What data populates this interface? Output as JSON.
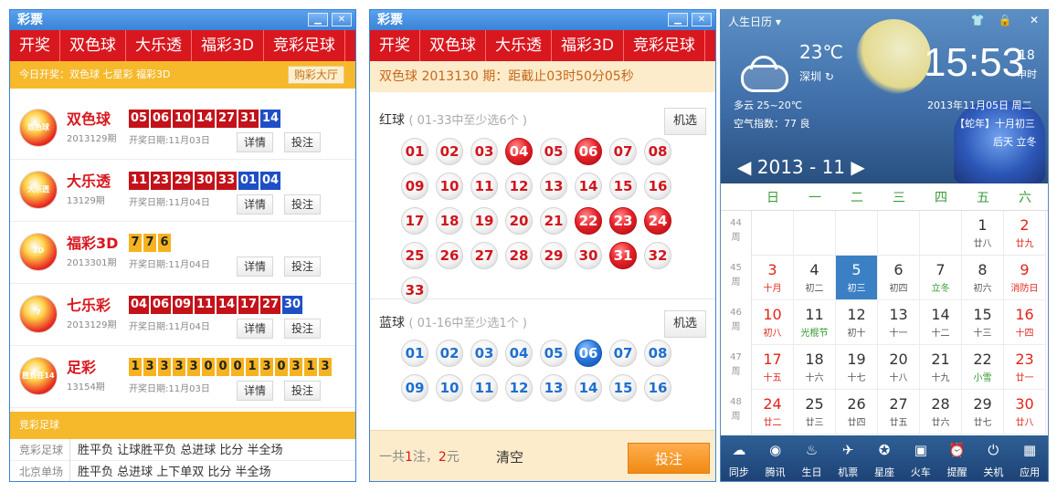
{
  "lottery_window": {
    "title": "彩票",
    "nav": [
      "开奖",
      "双色球",
      "大乐透",
      "福彩3D",
      "竞彩足球"
    ],
    "today_bar": "今日开奖：双色球 七星彩 福彩3D",
    "hall_button": "购彩大厅",
    "rows": [
      {
        "logo_text": "双色球",
        "name": "双色球",
        "issue": "2013129期",
        "date": "开奖日期:11月03日",
        "red": [
          "05",
          "06",
          "10",
          "14",
          "27",
          "31"
        ],
        "blue": [
          "14"
        ]
      },
      {
        "logo_text": "大乐透",
        "name": "大乐透",
        "issue": "13129期",
        "date": "开奖日期:11月04日",
        "red": [
          "11",
          "23",
          "29",
          "30",
          "33"
        ],
        "blue": [
          "01",
          "04"
        ]
      },
      {
        "logo_text": "3D",
        "name": "福彩3D",
        "issue": "2013301期",
        "date": "开奖日期:11月04日",
        "yellow": [
          "7",
          "7",
          "6"
        ]
      },
      {
        "logo_text": "7",
        "name": "七乐彩",
        "issue": "2013129期",
        "date": "开奖日期:11月04日",
        "red": [
          "04",
          "06",
          "09",
          "11",
          "14",
          "17",
          "27"
        ],
        "blue": [
          "30"
        ]
      },
      {
        "logo_text": "胜负任14",
        "name": "足彩",
        "issue": "13154期",
        "date": "开奖日期:11月03日",
        "yellow": [
          "1",
          "3",
          "3",
          "3",
          "3",
          "0",
          "0",
          "0",
          "1",
          "3",
          "0",
          "3",
          "1",
          "3"
        ]
      }
    ],
    "detail_label": "详情",
    "bet_label": "投注",
    "football_header": "竞彩足球",
    "football_lines": [
      {
        "title": "竞彩足球",
        "items": "胜平负 让球胜平负 总进球 比分 半全场"
      },
      {
        "title": "北京单场",
        "items": "胜平负 总进球 上下单双 比分 半全场"
      }
    ]
  },
  "picker_window": {
    "title": "彩票",
    "nav": [
      "开奖",
      "双色球",
      "大乐透",
      "福彩3D",
      "竞彩足球"
    ],
    "deadline": "双色球 2013130 期：距截止03时50分05秒",
    "red_title": "红球",
    "red_hint": "( 01-33中至少选6个 )",
    "blue_title": "蓝球",
    "blue_hint": "( 01-16中至少选1个 )",
    "random_label": "机选",
    "red_balls": [
      "01",
      "02",
      "03",
      "04",
      "05",
      "06",
      "07",
      "08",
      "09",
      "10",
      "11",
      "12",
      "13",
      "14",
      "15",
      "16",
      "17",
      "18",
      "19",
      "20",
      "21",
      "22",
      "23",
      "24",
      "25",
      "26",
      "27",
      "28",
      "29",
      "30",
      "31",
      "32",
      "33"
    ],
    "red_selected": [
      "04",
      "06",
      "22",
      "23",
      "24",
      "31"
    ],
    "blue_balls": [
      "01",
      "02",
      "03",
      "04",
      "05",
      "06",
      "07",
      "08",
      "09",
      "10",
      "11",
      "12",
      "13",
      "14",
      "15",
      "16"
    ],
    "blue_selected": [
      "06"
    ],
    "total_prefix": "一共",
    "total_count": "1",
    "total_mid": "注，",
    "total_amount": "2",
    "total_suffix": "元",
    "clear_label": "清空",
    "bet_label": "投注"
  },
  "calendar_window": {
    "title": "人生日历",
    "temperature": "23℃",
    "city": "深圳",
    "time": "15:53",
    "time_suffix_top": "18",
    "time_suffix_bottom": "申时",
    "weather": "多云 25~20℃",
    "air": "空气指数：77 良",
    "date": "2013年11月05日 周二",
    "lunar": "【蛇年】十月初三",
    "next": "后天 立冬",
    "month_label": "◀ 2013 - 11 ▶",
    "weekdays": [
      "日",
      "一",
      "二",
      "三",
      "四",
      "五",
      "六"
    ],
    "week_rows": [
      {
        "week": "44",
        "label": "周",
        "days": [
          {
            "d": "",
            "l": ""
          },
          {
            "d": "",
            "l": ""
          },
          {
            "d": "",
            "l": ""
          },
          {
            "d": "",
            "l": ""
          },
          {
            "d": "",
            "l": ""
          },
          {
            "d": "1",
            "l": "廿八"
          },
          {
            "d": "2",
            "l": "廿九"
          }
        ]
      },
      {
        "week": "45",
        "label": "周",
        "days": [
          {
            "d": "3",
            "l": "十月"
          },
          {
            "d": "4",
            "l": "初二"
          },
          {
            "d": "5",
            "l": "初三"
          },
          {
            "d": "6",
            "l": "初四"
          },
          {
            "d": "7",
            "l": "立冬"
          },
          {
            "d": "8",
            "l": "初六"
          },
          {
            "d": "9",
            "l": "消防日"
          }
        ]
      },
      {
        "week": "46",
        "label": "周",
        "days": [
          {
            "d": "10",
            "l": "初八"
          },
          {
            "d": "11",
            "l": "光棍节"
          },
          {
            "d": "12",
            "l": "初十"
          },
          {
            "d": "13",
            "l": "十一"
          },
          {
            "d": "14",
            "l": "十二"
          },
          {
            "d": "15",
            "l": "十三"
          },
          {
            "d": "16",
            "l": "十四"
          }
        ]
      },
      {
        "week": "47",
        "label": "周",
        "days": [
          {
            "d": "17",
            "l": "十五"
          },
          {
            "d": "18",
            "l": "十六"
          },
          {
            "d": "19",
            "l": "十七"
          },
          {
            "d": "20",
            "l": "十八"
          },
          {
            "d": "21",
            "l": "十九"
          },
          {
            "d": "22",
            "l": "小雪"
          },
          {
            "d": "23",
            "l": "廿一"
          }
        ]
      },
      {
        "week": "48",
        "label": "周",
        "days": [
          {
            "d": "24",
            "l": "廿二"
          },
          {
            "d": "25",
            "l": "廿三"
          },
          {
            "d": "26",
            "l": "廿四"
          },
          {
            "d": "27",
            "l": "廿五"
          },
          {
            "d": "28",
            "l": "廿六"
          },
          {
            "d": "29",
            "l": "廿七"
          },
          {
            "d": "30",
            "l": "廿八"
          }
        ]
      }
    ],
    "selected_day": "5",
    "toolbar": [
      {
        "icon": "☁",
        "label": "同步",
        "name": "sync"
      },
      {
        "icon": "◉",
        "label": "腾讯",
        "name": "tencent"
      },
      {
        "icon": "♨",
        "label": "生日",
        "name": "birthday"
      },
      {
        "icon": "✈",
        "label": "机票",
        "name": "flight"
      },
      {
        "icon": "✪",
        "label": "星座",
        "name": "horoscope"
      },
      {
        "icon": "▣",
        "label": "火车",
        "name": "train"
      },
      {
        "icon": "⏰",
        "label": "提醒",
        "name": "reminder"
      },
      {
        "icon": "⏻",
        "label": "关机",
        "name": "shutdown"
      },
      {
        "icon": "▦",
        "label": "应用",
        "name": "apps"
      }
    ]
  },
  "colors": {
    "brand_red": "#d9171e",
    "accent_yellow": "#f6b92c",
    "blue_ball": "#1e4fc6",
    "title_blue": "#3a83d6"
  }
}
